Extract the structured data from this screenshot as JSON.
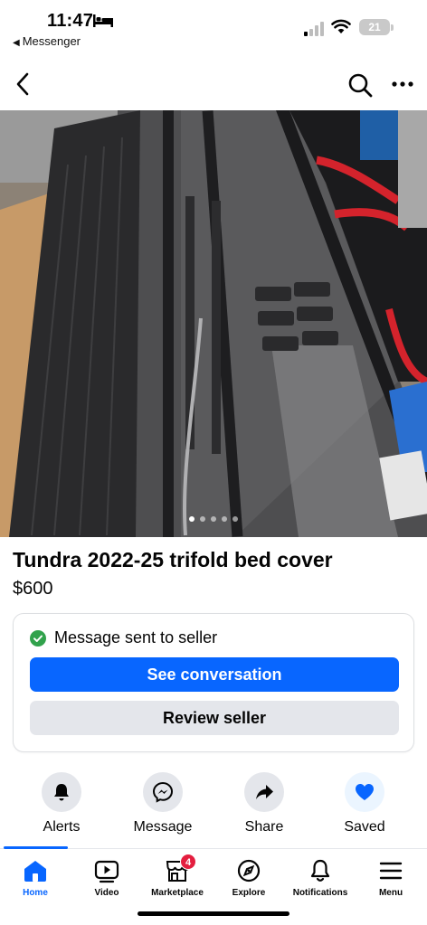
{
  "status_bar": {
    "time": "11:47",
    "back_app": "Messenger",
    "battery": "21"
  },
  "top_nav": {
    "icons": [
      "chevron-left-icon",
      "search-icon",
      "more-icon"
    ]
  },
  "photo": {
    "page_count": 5,
    "active_index": 0
  },
  "listing": {
    "title": "Tundra 2022-25 trifold bed cover",
    "price": "$600"
  },
  "message_card": {
    "status": "Message sent to seller",
    "primary_button": "See conversation",
    "secondary_button": "Review seller"
  },
  "actions": [
    {
      "label": "Alerts",
      "icon": "bell-icon"
    },
    {
      "label": "Message",
      "icon": "messenger-icon"
    },
    {
      "label": "Share",
      "icon": "share-icon"
    },
    {
      "label": "Saved",
      "icon": "heart-icon"
    }
  ],
  "tabs": [
    {
      "label": "Home",
      "icon": "home-icon",
      "active": true
    },
    {
      "label": "Video",
      "icon": "video-icon"
    },
    {
      "label": "Marketplace",
      "icon": "marketplace-icon",
      "badge": "4"
    },
    {
      "label": "Explore",
      "icon": "compass-icon"
    },
    {
      "label": "Notifications",
      "icon": "bell-icon"
    },
    {
      "label": "Menu",
      "icon": "hamburger-icon"
    }
  ],
  "colors": {
    "accent": "#0866ff",
    "success": "#31a24c",
    "badge": "#e41e3f",
    "secondary_bg": "#e4e6eb"
  }
}
